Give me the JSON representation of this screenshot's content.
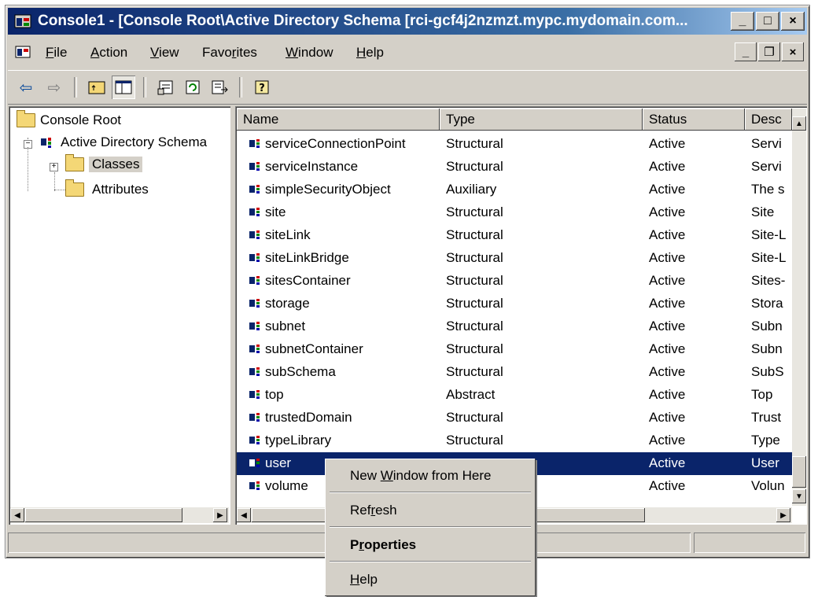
{
  "window": {
    "title": "Console1 - [Console Root\\Active Directory Schema [rci-gcf4j2nzmzt.mypc.mydomain.com...",
    "minimize": "_",
    "maximize": "□",
    "close": "×"
  },
  "menubar": {
    "items": [
      {
        "key": "F",
        "rest": "ile"
      },
      {
        "key": "A",
        "rest": "ction"
      },
      {
        "key": "V",
        "rest": "iew"
      },
      {
        "pre": "Favo",
        "key": "r",
        "rest": "ites"
      },
      {
        "key": "W",
        "rest": "indow"
      },
      {
        "key": "H",
        "rest": "elp"
      }
    ],
    "mdi_minimize": "_",
    "mdi_restore": "❐",
    "mdi_close": "×"
  },
  "tree": {
    "root": "Console Root",
    "schema": "Active Directory Schema",
    "classes": "Classes",
    "attributes": "Attributes"
  },
  "list": {
    "columns": [
      "Name",
      "Type",
      "Status",
      "Desc"
    ],
    "rows": [
      {
        "name": "serviceConnectionPoint",
        "type": "Structural",
        "status": "Active",
        "desc": "Servi"
      },
      {
        "name": "serviceInstance",
        "type": "Structural",
        "status": "Active",
        "desc": "Servi"
      },
      {
        "name": "simpleSecurityObject",
        "type": "Auxiliary",
        "status": "Active",
        "desc": "The s"
      },
      {
        "name": "site",
        "type": "Structural",
        "status": "Active",
        "desc": "Site"
      },
      {
        "name": "siteLink",
        "type": "Structural",
        "status": "Active",
        "desc": "Site-L"
      },
      {
        "name": "siteLinkBridge",
        "type": "Structural",
        "status": "Active",
        "desc": "Site-L"
      },
      {
        "name": "sitesContainer",
        "type": "Structural",
        "status": "Active",
        "desc": "Sites-"
      },
      {
        "name": "storage",
        "type": "Structural",
        "status": "Active",
        "desc": "Stora"
      },
      {
        "name": "subnet",
        "type": "Structural",
        "status": "Active",
        "desc": "Subn"
      },
      {
        "name": "subnetContainer",
        "type": "Structural",
        "status": "Active",
        "desc": "Subn"
      },
      {
        "name": "subSchema",
        "type": "Structural",
        "status": "Active",
        "desc": "SubS"
      },
      {
        "name": "top",
        "type": "Abstract",
        "status": "Active",
        "desc": "Top"
      },
      {
        "name": "trustedDomain",
        "type": "Structural",
        "status": "Active",
        "desc": "Trust"
      },
      {
        "name": "typeLibrary",
        "type": "Structural",
        "status": "Active",
        "desc": "Type"
      },
      {
        "name": "user",
        "type": "",
        "status": "Active",
        "desc": "User"
      },
      {
        "name": "volume",
        "type": "",
        "status": "Active",
        "desc": "Volun"
      }
    ]
  },
  "context_menu": {
    "new_window": {
      "pre": "New ",
      "key": "W",
      "rest": "indow from Here"
    },
    "refresh": {
      "pre": "Ref",
      "key": "r",
      "rest": "esh"
    },
    "properties": {
      "pre": "P",
      "key": "r",
      "rest": "operties"
    },
    "help": {
      "pre": "",
      "key": "H",
      "rest": "elp"
    }
  },
  "colors": {
    "title_active": "#0a246a",
    "selection": "#0a246a",
    "face": "#d4d0c8"
  }
}
